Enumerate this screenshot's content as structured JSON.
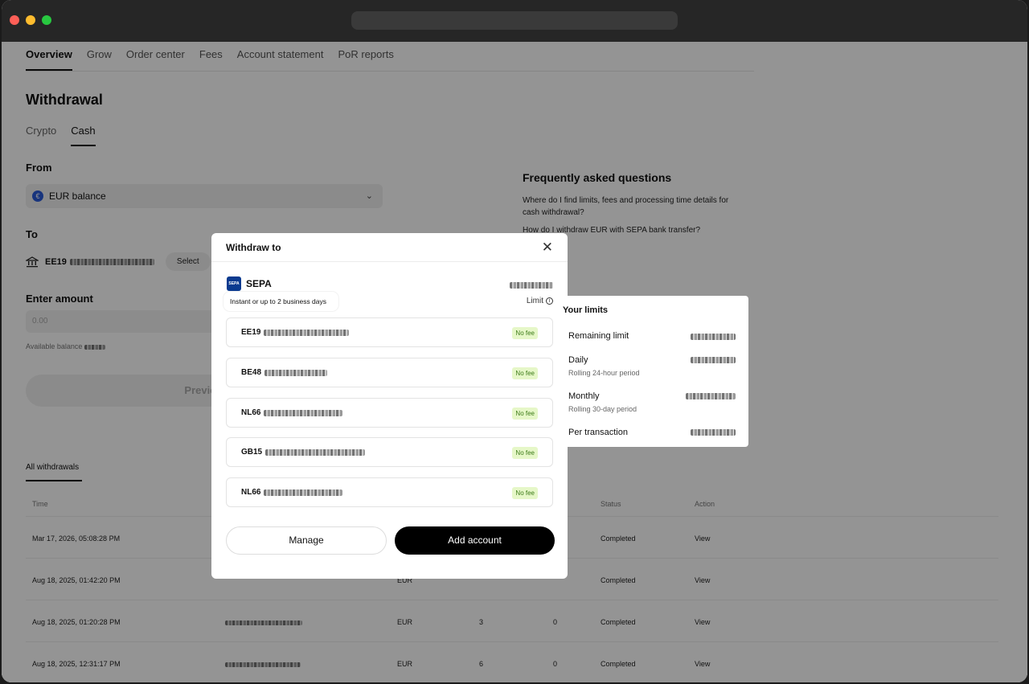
{
  "nav": {
    "tabs": [
      "Overview",
      "Grow",
      "Order center",
      "Fees",
      "Account statement",
      "PoR reports"
    ]
  },
  "withdrawal": {
    "title": "Withdrawal",
    "tabs": [
      "Crypto",
      "Cash"
    ],
    "from_label": "From",
    "from_value": "EUR balance",
    "to_label": "To",
    "to_account_prefix": "EE19",
    "select_label": "Select",
    "amount_label": "Enter amount",
    "amount_placeholder": "0.00",
    "available_balance_label": "Available balance",
    "preview_label": "Preview"
  },
  "faq": {
    "title": "Frequently asked questions",
    "questions": [
      "Where do I find limits, fees and processing time details for cash withdrawal?",
      "How do I withdraw EUR with SEPA bank transfer?"
    ]
  },
  "history": {
    "tab_label": "All withdrawals",
    "headers": [
      "Time",
      "Status",
      "Action"
    ],
    "rows": [
      {
        "time": "Mar 17, 2026, 05:08:28 PM",
        "currency": "",
        "amount": "",
        "fee": "",
        "status": "Completed",
        "action": "View"
      },
      {
        "time": "Aug 18, 2025, 01:42:20 PM",
        "currency": "EUR",
        "amount": "",
        "fee": "",
        "status": "Completed",
        "action": "View"
      },
      {
        "time": "Aug 18, 2025, 01:20:28 PM",
        "currency": "EUR",
        "amount": "3",
        "fee": "0",
        "status": "Completed",
        "action": "View"
      },
      {
        "time": "Aug 18, 2025, 12:31:17 PM",
        "currency": "EUR",
        "amount": "6",
        "fee": "0",
        "status": "Completed",
        "action": "View"
      }
    ]
  },
  "modal": {
    "title": "Withdraw to",
    "method": "SEPA",
    "method_logo": "SEPA",
    "limit_label": "Limit",
    "tooltip": "Instant or up to 2 business days",
    "accounts": [
      {
        "prefix": "EE19",
        "fee_label": "No fee"
      },
      {
        "prefix": "BE48",
        "fee_label": "No fee"
      },
      {
        "prefix": "NL66",
        "fee_label": "No fee"
      },
      {
        "prefix": "GB15",
        "fee_label": "No fee"
      },
      {
        "prefix": "NL66",
        "fee_label": "No fee"
      }
    ],
    "manage_label": "Manage",
    "add_account_label": "Add account"
  },
  "limits": {
    "title": "Your limits",
    "items": [
      {
        "label": "Remaining limit",
        "sub": ""
      },
      {
        "label": "Daily",
        "sub": "Rolling 24-hour period"
      },
      {
        "label": "Monthly",
        "sub": "Rolling 30-day period"
      },
      {
        "label": "Per transaction",
        "sub": ""
      }
    ]
  },
  "icons": {
    "close": "close-icon",
    "chevron": "chevron-down-icon",
    "bank": "bank-icon",
    "info": "info-icon",
    "euro": "euro-icon"
  },
  "colors": {
    "accent": "#000000",
    "no_fee_bg": "#e6f7c8",
    "no_fee_text": "#3c7b17"
  }
}
